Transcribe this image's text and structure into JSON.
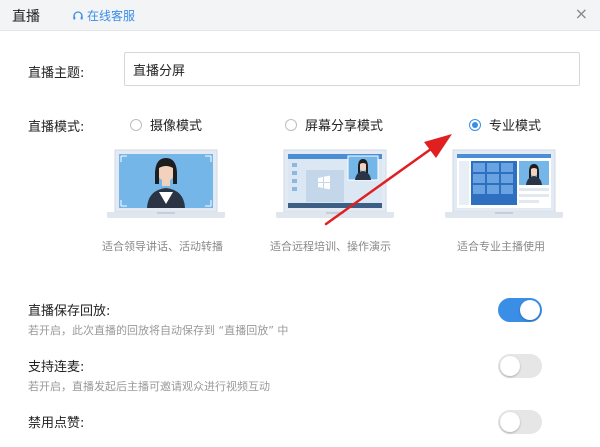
{
  "window": {
    "title": "直播",
    "customer_service": "在线客服",
    "close_glyph": "×"
  },
  "topic": {
    "label": "直播主题:",
    "value": "直播分屏"
  },
  "mode": {
    "label": "直播模式:",
    "options": [
      {
        "label": "摄像模式",
        "caption": "适合领导讲话、活动转播",
        "selected": false
      },
      {
        "label": "屏幕分享模式",
        "caption": "适合远程培训、操作演示",
        "selected": false
      },
      {
        "label": "专业模式",
        "caption": "适合专业主播使用",
        "selected": true
      }
    ]
  },
  "settings": [
    {
      "title": "直播保存回放:",
      "desc": "若开启，此次直播的回放将自动保存到 “直播回放” 中",
      "on": true
    },
    {
      "title": "支持连麦:",
      "desc": "若开启，直播发起后主播可邀请观众进行视频互动",
      "on": false
    },
    {
      "title": "禁用点赞:",
      "desc": "",
      "on": false
    }
  ],
  "colors": {
    "accent": "#3a8ee6",
    "annotation_arrow": "#e02020"
  }
}
